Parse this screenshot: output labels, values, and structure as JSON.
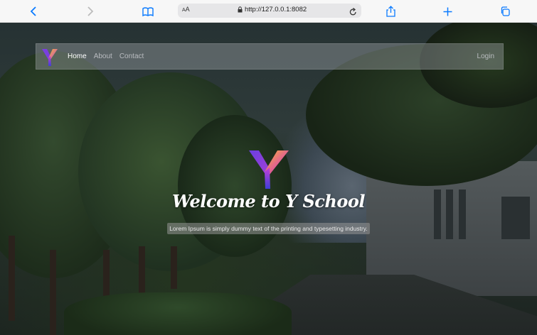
{
  "browser": {
    "text_size_label": "AA",
    "url": "http://127.0.0.1:8082"
  },
  "navbar": {
    "links": [
      {
        "label": "Home",
        "active": true
      },
      {
        "label": "About",
        "active": false
      },
      {
        "label": "Contact",
        "active": false
      }
    ],
    "login_label": "Login"
  },
  "hero": {
    "title": "Welcome to Y School",
    "subtitle": "Lorem Ipsum is simply dummy text of the printing and typesetting industry."
  },
  "colors": {
    "toolbar_icon": "#0a7aff",
    "logo_gradient": [
      "#f7b733",
      "#c33fd8",
      "#5b3fd8"
    ]
  }
}
